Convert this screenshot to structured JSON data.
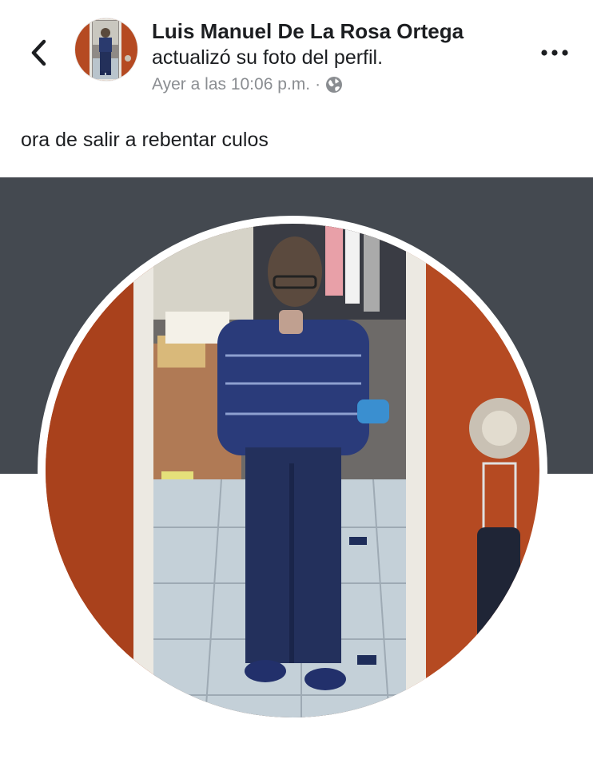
{
  "header": {
    "back_icon": "chevron-left-icon",
    "author_name": "Luis Manuel De La Rosa Ortega",
    "action": "actualizó su foto del perfil.",
    "timestamp": "Ayer a las 10:06 p.m.",
    "separator": "·",
    "privacy_icon": "globe-icon",
    "more_icon": "more-horizontal-icon"
  },
  "post": {
    "text": "ora de salir a rebentar culos"
  },
  "colors": {
    "cover_background": "#444950",
    "name_text": "#1c1e21",
    "meta_text": "#8a8d91",
    "door_orange": "#b54a22"
  }
}
